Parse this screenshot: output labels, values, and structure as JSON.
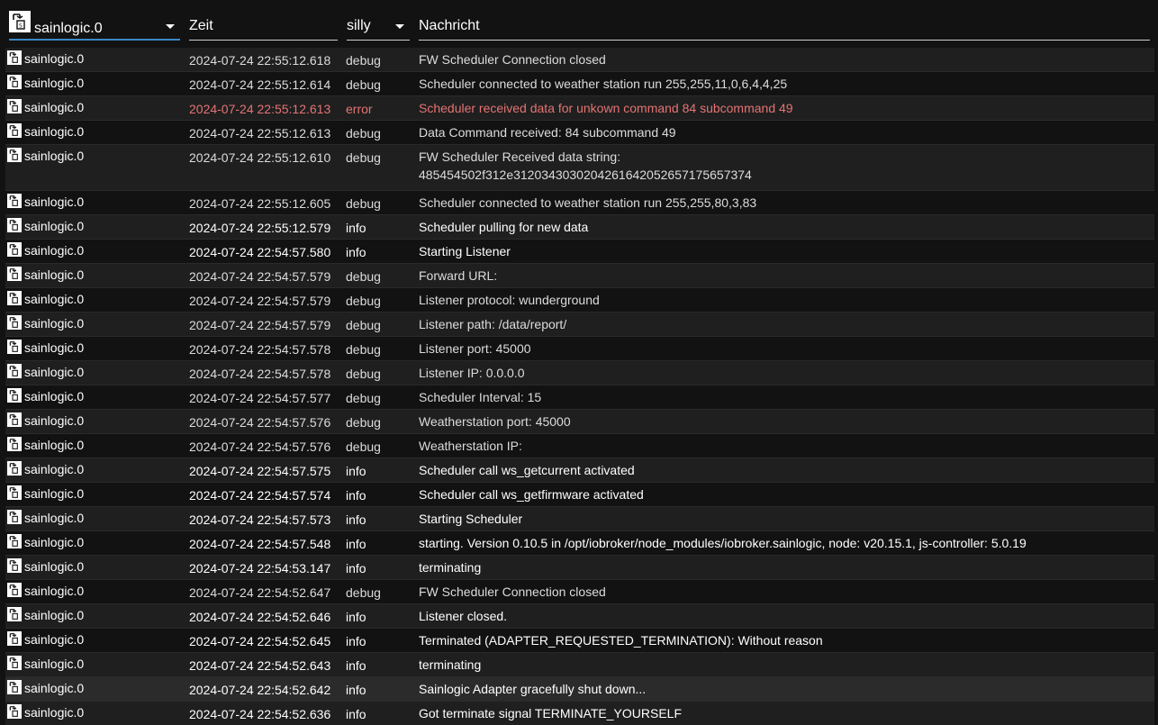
{
  "header": {
    "instance_filter": "sainlogic.0",
    "time_label": "Zeit",
    "level_filter": "silly",
    "message_label": "Nachricht"
  },
  "colors": {
    "error": "#e57373",
    "info": "#ffffff",
    "debug": "#dcdcdc",
    "accent": "#3b87c6"
  },
  "rows": [
    {
      "instance": "sainlogic.0",
      "time": "2024-07-24 22:55:12.618",
      "level": "debug",
      "message": "FW Scheduler Connection closed"
    },
    {
      "instance": "sainlogic.0",
      "time": "2024-07-24 22:55:12.614",
      "level": "debug",
      "message": "Scheduler connected to weather station run 255,255,11,0,6,4,4,25"
    },
    {
      "instance": "sainlogic.0",
      "time": "2024-07-24 22:55:12.613",
      "level": "error",
      "message": "Scheduler received data for unkown command 84 subcommand 49"
    },
    {
      "instance": "sainlogic.0",
      "time": "2024-07-24 22:55:12.613",
      "level": "debug",
      "message": "Data Command received: 84 subcommand 49"
    },
    {
      "instance": "sainlogic.0",
      "time": "2024-07-24 22:55:12.610",
      "level": "debug",
      "message": "FW Scheduler Received data string:",
      "message2": "485454502f312e3120343030204261642052657175657374"
    },
    {
      "instance": "sainlogic.0",
      "time": "2024-07-24 22:55:12.605",
      "level": "debug",
      "message": "Scheduler connected to weather station run 255,255,80,3,83"
    },
    {
      "instance": "sainlogic.0",
      "time": "2024-07-24 22:55:12.579",
      "level": "info",
      "message": "Scheduler pulling for new data"
    },
    {
      "instance": "sainlogic.0",
      "time": "2024-07-24 22:54:57.580",
      "level": "info",
      "message": "Starting Listener"
    },
    {
      "instance": "sainlogic.0",
      "time": "2024-07-24 22:54:57.579",
      "level": "debug",
      "message": "Forward URL:"
    },
    {
      "instance": "sainlogic.0",
      "time": "2024-07-24 22:54:57.579",
      "level": "debug",
      "message": "Listener protocol: wunderground"
    },
    {
      "instance": "sainlogic.0",
      "time": "2024-07-24 22:54:57.579",
      "level": "debug",
      "message": "Listener path: /data/report/"
    },
    {
      "instance": "sainlogic.0",
      "time": "2024-07-24 22:54:57.578",
      "level": "debug",
      "message": "Listener port: 45000"
    },
    {
      "instance": "sainlogic.0",
      "time": "2024-07-24 22:54:57.578",
      "level": "debug",
      "message": "Listener IP: 0.0.0.0"
    },
    {
      "instance": "sainlogic.0",
      "time": "2024-07-24 22:54:57.577",
      "level": "debug",
      "message": "Scheduler Interval: 15"
    },
    {
      "instance": "sainlogic.0",
      "time": "2024-07-24 22:54:57.576",
      "level": "debug",
      "message": "Weatherstation port: 45000"
    },
    {
      "instance": "sainlogic.0",
      "time": "2024-07-24 22:54:57.576",
      "level": "debug",
      "message": "Weatherstation IP:"
    },
    {
      "instance": "sainlogic.0",
      "time": "2024-07-24 22:54:57.575",
      "level": "info",
      "message": "Scheduler call ws_getcurrent activated"
    },
    {
      "instance": "sainlogic.0",
      "time": "2024-07-24 22:54:57.574",
      "level": "info",
      "message": "Scheduler call ws_getfirmware activated"
    },
    {
      "instance": "sainlogic.0",
      "time": "2024-07-24 22:54:57.573",
      "level": "info",
      "message": "Starting Scheduler"
    },
    {
      "instance": "sainlogic.0",
      "time": "2024-07-24 22:54:57.548",
      "level": "info",
      "message": "starting. Version 0.10.5 in /opt/iobroker/node_modules/iobroker.sainlogic, node: v20.15.1, js-controller: 5.0.19"
    },
    {
      "instance": "sainlogic.0",
      "time": "2024-07-24 22:54:53.147",
      "level": "info",
      "message": "terminating"
    },
    {
      "instance": "sainlogic.0",
      "time": "2024-07-24 22:54:52.647",
      "level": "debug",
      "message": "FW Scheduler Connection closed"
    },
    {
      "instance": "sainlogic.0",
      "time": "2024-07-24 22:54:52.646",
      "level": "info",
      "message": "Listener closed."
    },
    {
      "instance": "sainlogic.0",
      "time": "2024-07-24 22:54:52.645",
      "level": "info",
      "message": "Terminated (ADAPTER_REQUESTED_TERMINATION): Without reason"
    },
    {
      "instance": "sainlogic.0",
      "time": "2024-07-24 22:54:52.643",
      "level": "info",
      "message": "terminating"
    },
    {
      "instance": "sainlogic.0",
      "time": "2024-07-24 22:54:52.642",
      "level": "info",
      "message": "Sainlogic Adapter gracefully shut down..."
    },
    {
      "instance": "sainlogic.0",
      "time": "2024-07-24 22:54:52.636",
      "level": "info",
      "message": "Got terminate signal TERMINATE_YOURSELF"
    }
  ]
}
